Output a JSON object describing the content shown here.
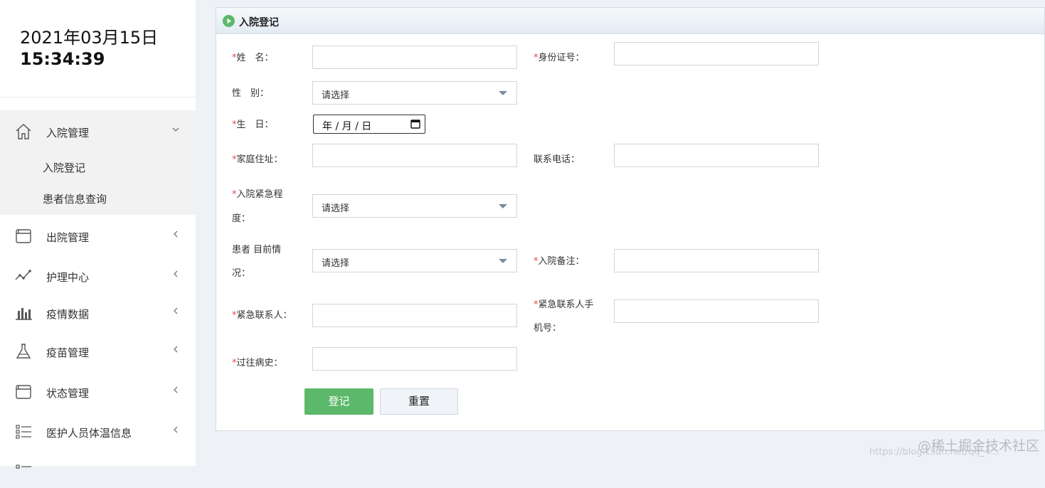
{
  "clock": {
    "date": "2021年03月15日",
    "time": "15:34:39"
  },
  "nav": {
    "admission": {
      "label": "入院管理",
      "icon": "home-icon",
      "sub": [
        "入院登记",
        "患者信息查询"
      ]
    },
    "items": [
      {
        "label": "出院管理",
        "icon": "window-icon"
      },
      {
        "label": "护理中心",
        "icon": "line-chart-icon"
      },
      {
        "label": "疫情数据",
        "icon": "bar-chart-icon"
      },
      {
        "label": "疫苗管理",
        "icon": "flask-icon"
      },
      {
        "label": "状态管理",
        "icon": "window-icon"
      },
      {
        "label": "医护人员体温信息",
        "icon": "list-icon"
      }
    ]
  },
  "panel": {
    "title": "入院登记"
  },
  "form": {
    "required_mark": "*",
    "name_label": "姓　名：",
    "id_label": "身份证号：",
    "gender_label": "性　别：",
    "gender_value": "请选择",
    "birthday_label": "生　日：",
    "birthday_value": "年 / 月 / 日",
    "address_label": "家庭住址：",
    "phone_label": "联系电话：",
    "urgency_label_1": "入院紧急程",
    "urgency_label_2": "度：",
    "urgency_value": "请选择",
    "condition_label_1": "患者 目前情",
    "condition_label_2": "况：",
    "condition_value": "请选择",
    "remark_label": "入院备注：",
    "contact_label": "紧急联系人：",
    "contact_phone_label_1": "紧急联系人手",
    "contact_phone_label_2": "机号：",
    "history_label": "过往病史：",
    "submit_label": "登记",
    "reset_label": "重置"
  },
  "watermark": {
    "text": "@稀土掘金技术社区",
    "url": "https://blog.csdn.net/qq_4..."
  },
  "colors": {
    "accent_green": "#5cb86a",
    "required_red": "#e34c4c"
  }
}
